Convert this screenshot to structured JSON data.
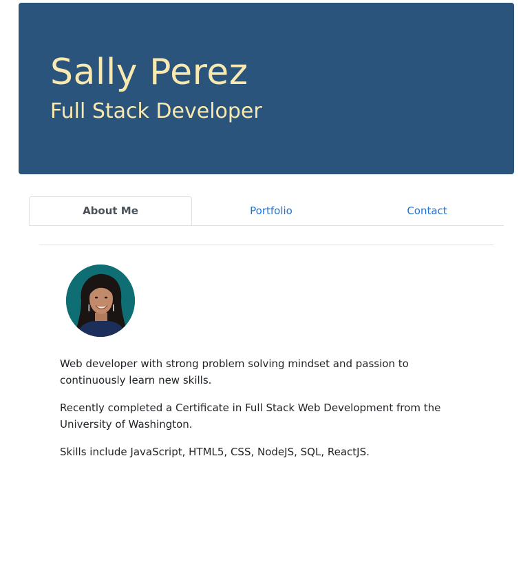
{
  "header": {
    "name": "Sally Perez",
    "role": "Full Stack Developer"
  },
  "tabs": [
    {
      "label": "About Me",
      "active": true
    },
    {
      "label": "Portfolio",
      "active": false
    },
    {
      "label": "Contact",
      "active": false
    }
  ],
  "about": {
    "paragraphs": [
      "Web developer with strong problem solving mindset and passion to continuously learn new skills.",
      "Recently completed a Certificate in Full Stack Web Development from the University of Washington.",
      "Skills include JavaScript, HTML5, CSS, NodeJS, SQL, ReactJS."
    ]
  },
  "colors": {
    "hero_bg": "#2b547c",
    "hero_text": "#f8e9b0",
    "link": "#1a73d9",
    "avatar_bg": "#0f6e73"
  }
}
